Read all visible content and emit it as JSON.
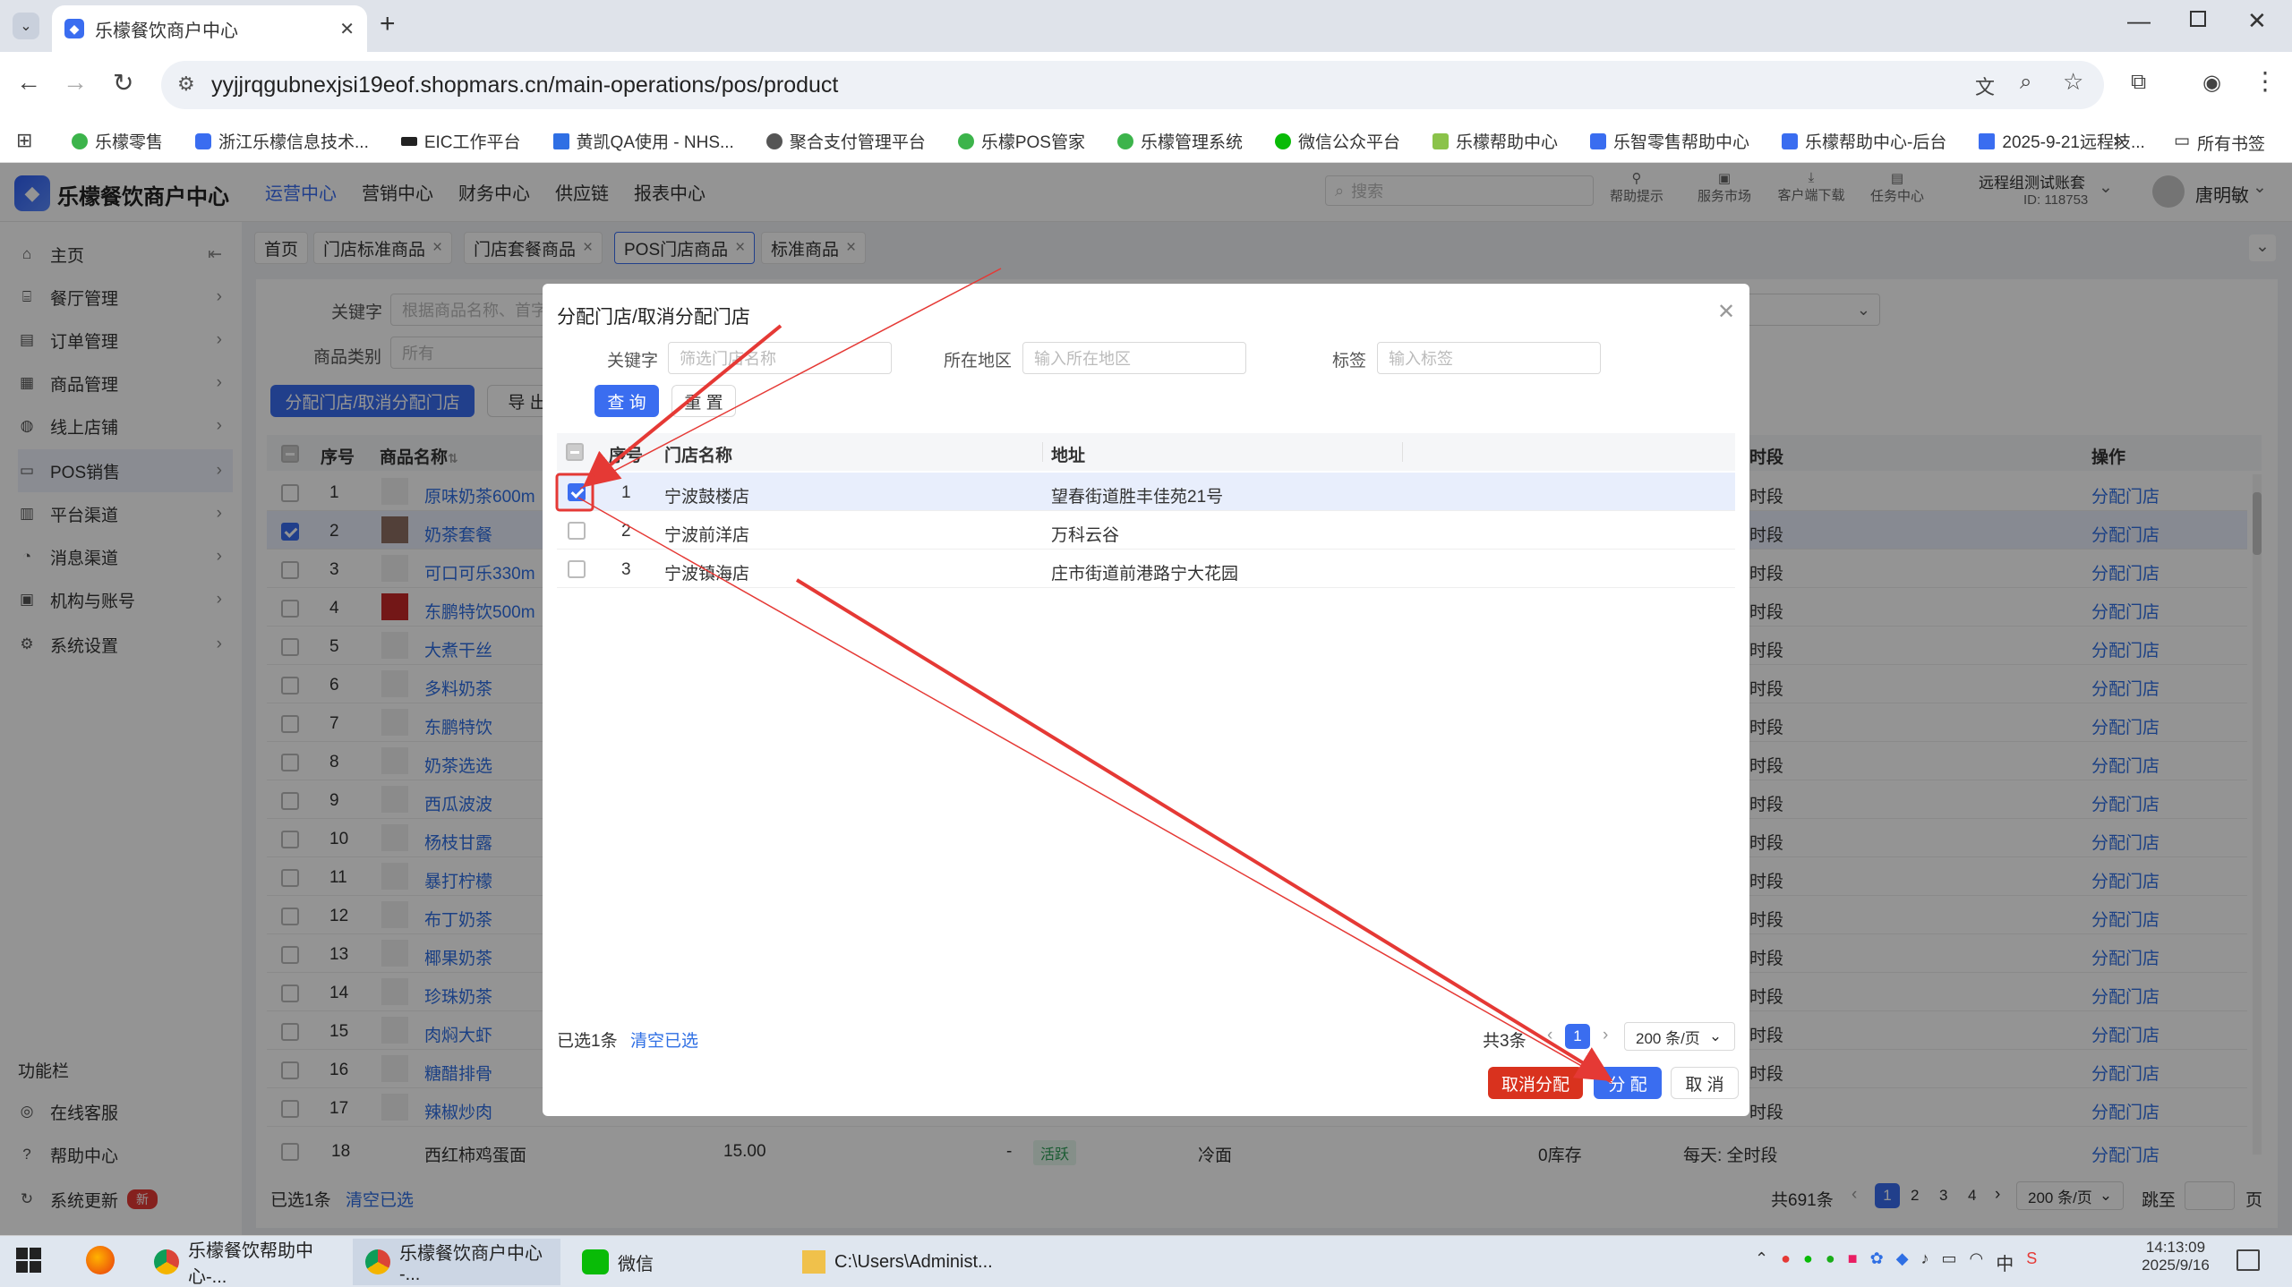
{
  "browser": {
    "tab_title": "乐檬餐饮商户中心",
    "url": "yyjjrqgubnexjsi19eof.shopmars.cn/main-operations/pos/product",
    "bookmarks": [
      "乐檬零售",
      "浙江乐檬信息技术...",
      "EIC工作平台",
      "黄凯QA使用 - NHS...",
      "聚合支付管理平台",
      "乐檬POS管家",
      "乐檬管理系统",
      "微信公众平台",
      "乐檬帮助中心",
      "乐智零售帮助中心",
      "乐檬帮助中心-后台",
      "2025-9-21远程技...",
      "所有书签"
    ]
  },
  "app": {
    "title": "乐檬餐饮商户中心",
    "topnav": [
      "运营中心",
      "营销中心",
      "财务中心",
      "供应链",
      "报表中心"
    ],
    "search_placeholder": "搜索",
    "tools": [
      "帮助提示",
      "服务市场",
      "客户端下载",
      "任务中心"
    ],
    "account_name": "远程组测试账套",
    "account_id": "ID: 118753",
    "user": "唐明敏"
  },
  "sidebar": {
    "items": [
      "主页",
      "餐厅管理",
      "订单管理",
      "商品管理",
      "线上店铺",
      "POS销售",
      "平台渠道",
      "消息渠道",
      "机构与账号",
      "系统设置"
    ],
    "section_title": "功能栏",
    "extras": [
      "在线客服",
      "帮助中心",
      "系统更新"
    ],
    "new_badge": "新"
  },
  "tabs": [
    "首页",
    "门店标准商品",
    "门店套餐商品",
    "POS门店商品",
    "标准商品"
  ],
  "filters": {
    "keyword_label": "关键字",
    "keyword_placeholder": "根据商品名称、首字",
    "category_label": "商品类别",
    "category_value": "所有"
  },
  "actions": {
    "assign": "分配门店/取消分配门店",
    "export": "导 出"
  },
  "table": {
    "headers": {
      "seq": "序号",
      "name": "商品名称",
      "time": "时段",
      "op": "操作"
    },
    "rows": [
      {
        "seq": "1",
        "name": "原味奶茶600m",
        "time": "时段",
        "op": "分配门店",
        "checked": false
      },
      {
        "seq": "2",
        "name": "奶茶套餐",
        "time": "时段",
        "op": "分配门店",
        "checked": true
      },
      {
        "seq": "3",
        "name": "可口可乐330m",
        "time": "时段",
        "op": "分配门店",
        "checked": false
      },
      {
        "seq": "4",
        "name": "东鹏特饮500m",
        "time": "时段",
        "op": "分配门店",
        "checked": false
      },
      {
        "seq": "5",
        "name": "大煮干丝",
        "time": "时段",
        "op": "分配门店",
        "checked": false
      },
      {
        "seq": "6",
        "name": "多料奶茶",
        "time": "时段",
        "op": "分配门店",
        "checked": false
      },
      {
        "seq": "7",
        "name": "东鹏特饮",
        "time": "时段",
        "op": "分配门店",
        "checked": false
      },
      {
        "seq": "8",
        "name": "奶茶选选",
        "time": "时段",
        "op": "分配门店",
        "checked": false
      },
      {
        "seq": "9",
        "name": "西瓜波波",
        "time": "时段",
        "op": "分配门店",
        "checked": false
      },
      {
        "seq": "10",
        "name": "杨枝甘露",
        "time": "时段",
        "op": "分配门店",
        "checked": false
      },
      {
        "seq": "11",
        "name": "暴打柠檬",
        "time": "时段",
        "op": "分配门店",
        "checked": false
      },
      {
        "seq": "12",
        "name": "布丁奶茶",
        "time": "时段",
        "op": "分配门店",
        "checked": false
      },
      {
        "seq": "13",
        "name": "椰果奶茶",
        "time": "时段",
        "op": "分配门店",
        "checked": false
      },
      {
        "seq": "14",
        "name": "珍珠奶茶",
        "time": "时段",
        "op": "分配门店",
        "checked": false
      },
      {
        "seq": "15",
        "name": "肉焖大虾",
        "time": "时段",
        "op": "分配门店",
        "checked": false
      },
      {
        "seq": "16",
        "name": "糖醋排骨",
        "time": "时段",
        "op": "分配门店",
        "checked": false
      },
      {
        "seq": "17",
        "name": "辣椒炒肉",
        "time": "时段",
        "op": "分配门店",
        "checked": false
      }
    ],
    "last_row": {
      "seq": "18",
      "name": "西红柿鸡蛋面",
      "price": "15.00",
      "dash": "-",
      "status": "活跃",
      "category": "冷面",
      "stock": "0库存",
      "time": "每天: 全时段",
      "op": "分配门店"
    },
    "selected_text": "已选1条",
    "clear_text": "清空已选",
    "total": "共691条",
    "pages": [
      "1",
      "2",
      "3",
      "4"
    ],
    "page_size": "200 条/页",
    "jump_label": "跳至",
    "page_unit": "页"
  },
  "dialog": {
    "title": "分配门店/取消分配门店",
    "keyword_label": "关键字",
    "keyword_placeholder": "筛选门店名称",
    "region_label": "所在地区",
    "region_placeholder": "输入所在地区",
    "tag_label": "标签",
    "tag_placeholder": "输入标签",
    "query": "查 询",
    "reset": "重 置",
    "headers": {
      "seq": "序号",
      "store": "门店名称",
      "addr": "地址"
    },
    "rows": [
      {
        "seq": "1",
        "store": "宁波鼓楼店",
        "addr": "望春街道胜丰佳苑21号",
        "checked": true
      },
      {
        "seq": "2",
        "store": "宁波前洋店",
        "addr": "万科云谷",
        "checked": false
      },
      {
        "seq": "3",
        "store": "宁波镇海店",
        "addr": "庄市街道前港路宁大花园",
        "checked": false
      }
    ],
    "selected_text": "已选1条",
    "clear_text": "清空已选",
    "total": "共3条",
    "page": "1",
    "page_size": "200 条/页",
    "cancel_assign": "取消分配",
    "assign": "分 配",
    "cancel": "取 消"
  },
  "taskbar": {
    "items": [
      "乐檬餐饮帮助中心-...",
      "乐檬餐饮商户中心 -...",
      "微信",
      "C:\\Users\\Administ..."
    ],
    "ime": "中",
    "time": "14:13:09",
    "date": "2025/9/16"
  },
  "colors": {
    "primary": "#3a6df0",
    "danger": "#d9321e",
    "link": "#2f6fe4",
    "annotation": "#e53935"
  }
}
